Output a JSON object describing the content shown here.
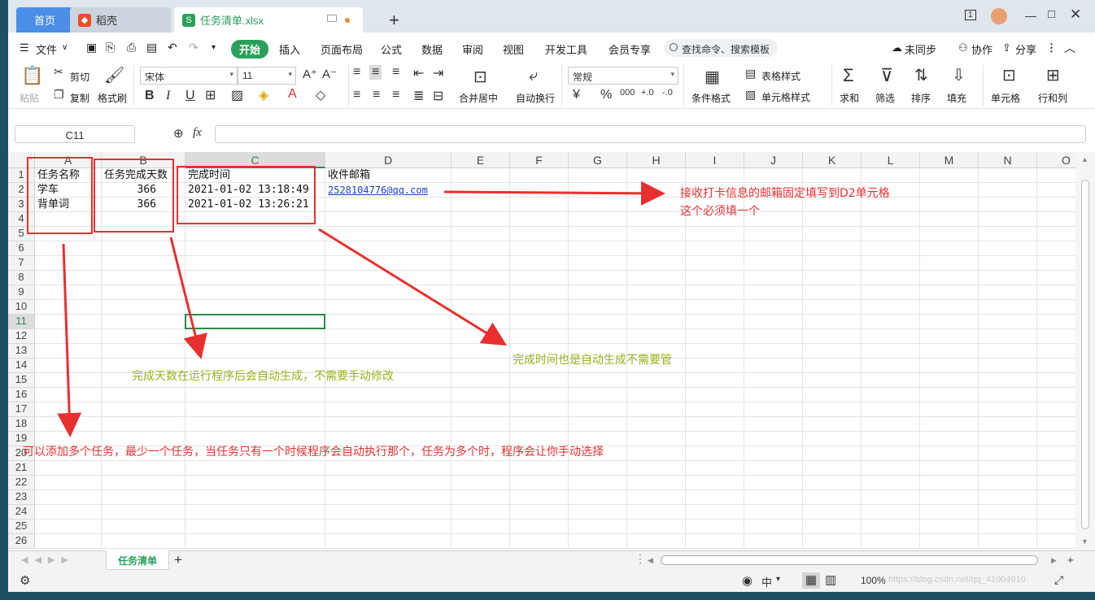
{
  "tabs": {
    "home": "首页",
    "draft": "稻壳",
    "file": "任务清单.xlsx",
    "count_badge": "1"
  },
  "menu": {
    "file": "文件",
    "items": [
      "开始",
      "插入",
      "页面布局",
      "公式",
      "数据",
      "审阅",
      "视图",
      "开发工具",
      "会员专享"
    ],
    "search": "查找命令、搜索模板",
    "sync": "未同步",
    "collab": "协作",
    "share": "分享"
  },
  "ribbon": {
    "paste": "粘贴",
    "cut": "剪切",
    "copy": "复制",
    "format_painter": "格式刷",
    "font_name": "宋体",
    "font_size": "11",
    "merge": "合并居中",
    "wrap": "自动换行",
    "number_format": "常规",
    "cond_format": "条件格式",
    "table_style": "表格样式",
    "cell_style": "单元格样式",
    "sum": "求和",
    "filter": "筛选",
    "sort": "排序",
    "fill": "填充",
    "cell": "单元格",
    "rowcol": "行和列",
    "bold": "B",
    "italic": "I",
    "underline": "U"
  },
  "formula_bar": {
    "cell_ref": "C11",
    "fx": "fx",
    "content": ""
  },
  "columns": [
    "A",
    "B",
    "C",
    "D",
    "E",
    "F",
    "G",
    "H",
    "I",
    "J",
    "K",
    "L",
    "M",
    "N",
    "O"
  ],
  "rows": [
    "1",
    "2",
    "3",
    "4",
    "5",
    "6",
    "7",
    "8",
    "9",
    "10",
    "11",
    "12",
    "13",
    "14",
    "15",
    "16",
    "17",
    "18",
    "19",
    "20",
    "21",
    "22",
    "23",
    "24",
    "25",
    "26"
  ],
  "cells": {
    "A1": "任务名称",
    "B1": "任务完成天数",
    "C1": "完成时间",
    "D1": "收件邮箱",
    "A2": "学车",
    "B2": "366",
    "C2": "2021-01-02 13:18:49",
    "D2": "2528104776@qq.com",
    "A3": "背单词",
    "B3": "366",
    "C3": "2021-01-02 13:26:21"
  },
  "sheet_tab": "任务清单",
  "status": {
    "zoom": "100%",
    "cn": "中",
    "watermark": "https://blog.csdn.net/qq_41004910"
  },
  "annotations": {
    "email_note_1": "接收打卡信息的邮箱固定填写到D2单元格",
    "email_note_2": "这个必须填一个",
    "time_note": "完成时间也是自动生成不需要管",
    "days_note": "完成天数在运行程序后会自动生成，不需要手动修改",
    "task_note": "可以添加多个任务，最少一个任务，当任务只有一个时候程序会自动执行那个，任务为多个时，程序会让你手动选择"
  },
  "colors": {
    "accent_green": "#2aa05a",
    "annotation_red": "#e83030",
    "annotation_green": "#9ab21c",
    "link_blue": "#1a3fd0"
  }
}
